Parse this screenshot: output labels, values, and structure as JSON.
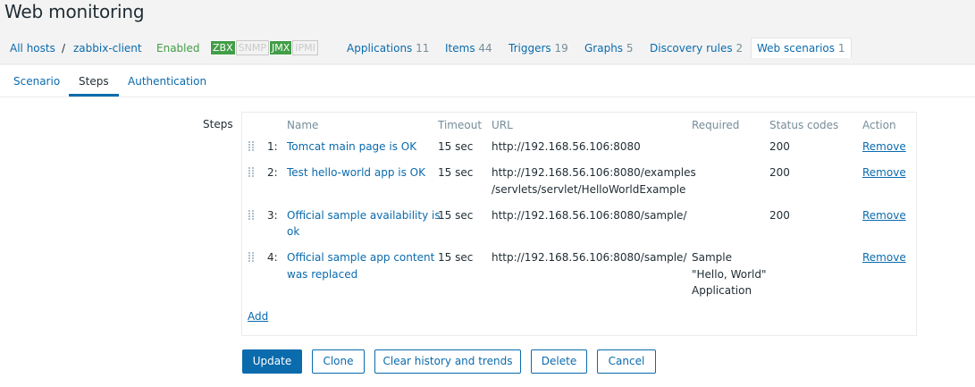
{
  "title": "Web monitoring",
  "hostnav": {
    "all_hosts": "All hosts",
    "separator": "/",
    "host": "zabbix-client",
    "status": "Enabled",
    "availability": [
      "ZBX",
      "SNMP",
      "JMX",
      "IPMI"
    ],
    "applications": {
      "label": "Applications",
      "count": "11"
    },
    "items": {
      "label": "Items",
      "count": "44"
    },
    "triggers": {
      "label": "Triggers",
      "count": "19"
    },
    "graphs": {
      "label": "Graphs",
      "count": "5"
    },
    "discovery": {
      "label": "Discovery rules",
      "count": "2"
    },
    "web": {
      "label": "Web scenarios",
      "count": "1"
    }
  },
  "tabs": [
    "Scenario",
    "Steps",
    "Authentication"
  ],
  "steps_label": "Steps",
  "columns": [
    "Name",
    "Timeout",
    "URL",
    "Required",
    "Status codes",
    "Action"
  ],
  "steps": [
    {
      "num": "1:",
      "name1": "Tomcat main page is OK",
      "name2": "",
      "timeout": "15 sec",
      "url1": "http://192.168.56.106:8080",
      "url2": "",
      "req1": "",
      "req2": "",
      "req3": "",
      "status": "200",
      "action": "Remove"
    },
    {
      "num": "2:",
      "name1": "Test hello-world app is OK",
      "name2": "",
      "timeout": "15 sec",
      "url1": "http://192.168.56.106:8080/examples",
      "url2": "/servlets/servlet/HelloWorldExample",
      "req1": "",
      "req2": "",
      "req3": "",
      "status": "200",
      "action": "Remove"
    },
    {
      "num": "3:",
      "name1": "Official sample availability is",
      "name2": "ok",
      "timeout": "15 sec",
      "url1": "http://192.168.56.106:8080/sample/",
      "url2": "",
      "req1": "",
      "req2": "",
      "req3": "",
      "status": "200",
      "action": "Remove"
    },
    {
      "num": "4:",
      "name1": "Official sample app content",
      "name2": "was replaced",
      "timeout": "15 sec",
      "url1": "http://192.168.56.106:8080/sample/",
      "url2": "",
      "req1": "Sample",
      "req2": "\"Hello, World\"",
      "req3": "Application",
      "status": "",
      "action": "Remove"
    }
  ],
  "add_label": "Add",
  "buttons": {
    "update": "Update",
    "clone": "Clone",
    "clear": "Clear history and trends",
    "delete": "Delete",
    "cancel": "Cancel"
  }
}
